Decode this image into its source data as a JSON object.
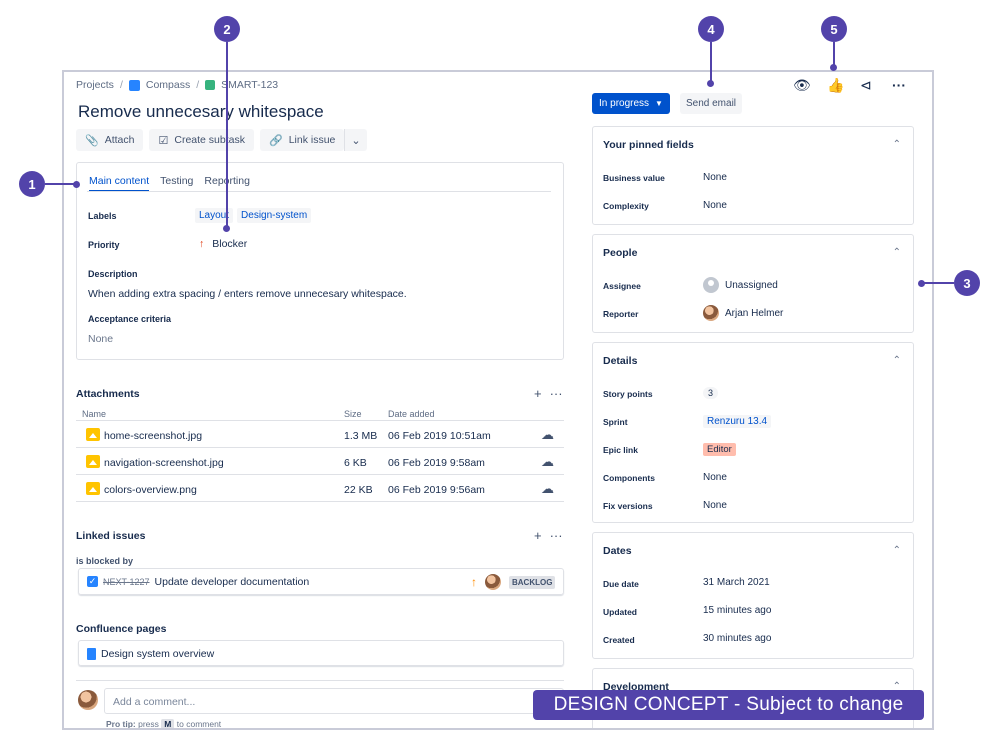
{
  "breadcrumb": {
    "projects": "Projects",
    "project": "Compass",
    "issue_key": "SMART-123"
  },
  "issue": {
    "title": "Remove unnecesary whitespace"
  },
  "toolbar": {
    "attach": "Attach",
    "create_subtask": "Create subtask",
    "link_issue": "Link issue"
  },
  "tabs": [
    "Main content",
    "Testing",
    "Reporting"
  ],
  "fields": {
    "labels_label": "Labels",
    "labels": [
      "Layout",
      "Design-system"
    ],
    "priority_label": "Priority",
    "priority": "Blocker",
    "description_label": "Description",
    "description": "When adding extra spacing / enters remove unnecesary whitespace.",
    "acceptance_label": "Acceptance criteria",
    "acceptance": "None"
  },
  "attachments": {
    "title": "Attachments",
    "columns": [
      "Name",
      "Size",
      "Date added"
    ],
    "rows": [
      {
        "name": "home-screenshot.jpg",
        "size": "1.3 MB",
        "date": "06 Feb 2019 10:51am"
      },
      {
        "name": "navigation-screenshot.jpg",
        "size": "6 KB",
        "date": "06 Feb 2019 9:58am"
      },
      {
        "name": "colors-overview.png",
        "size": "22 KB",
        "date": "06 Feb 2019 9:56am"
      }
    ]
  },
  "linked": {
    "title": "Linked issues",
    "relation": "is blocked by",
    "key": "NEXT-1227",
    "summary": "Update developer documentation",
    "status": "BACKLOG"
  },
  "confluence": {
    "title": "Confluence pages",
    "page": "Design system overview"
  },
  "comment": {
    "placeholder": "Add a comment...",
    "protip_prefix": "Pro tip:",
    "protip_press": "press",
    "protip_key": "M",
    "protip_suffix": "to comment"
  },
  "status": {
    "label": "In progress",
    "send_email": "Send email"
  },
  "pinned": {
    "title": "Your pinned fields",
    "business_value_label": "Business value",
    "business_value": "None",
    "complexity_label": "Complexity",
    "complexity": "None"
  },
  "people": {
    "title": "People",
    "assignee_label": "Assignee",
    "assignee": "Unassigned",
    "reporter_label": "Reporter",
    "reporter": "Arjan Helmer"
  },
  "details": {
    "title": "Details",
    "story_points_label": "Story points",
    "story_points": "3",
    "sprint_label": "Sprint",
    "sprint": "Renzuru 13.4",
    "epic_label": "Epic link",
    "epic": "Editor",
    "components_label": "Components",
    "components": "None",
    "fix_versions_label": "Fix versions",
    "fix_versions": "None"
  },
  "dates": {
    "title": "Dates",
    "due_label": "Due date",
    "due": "31 March 2021",
    "updated_label": "Updated",
    "updated": "15 minutes ago",
    "created_label": "Created",
    "created": "30 minutes ago"
  },
  "development": {
    "title": "Development"
  },
  "callouts": [
    "1",
    "2",
    "3",
    "4",
    "5"
  ],
  "banner": "DESIGN CONCEPT - Subject to change",
  "colors": {
    "accent": "#5243aa",
    "primary": "#0052cc",
    "priority": "#de350b"
  }
}
